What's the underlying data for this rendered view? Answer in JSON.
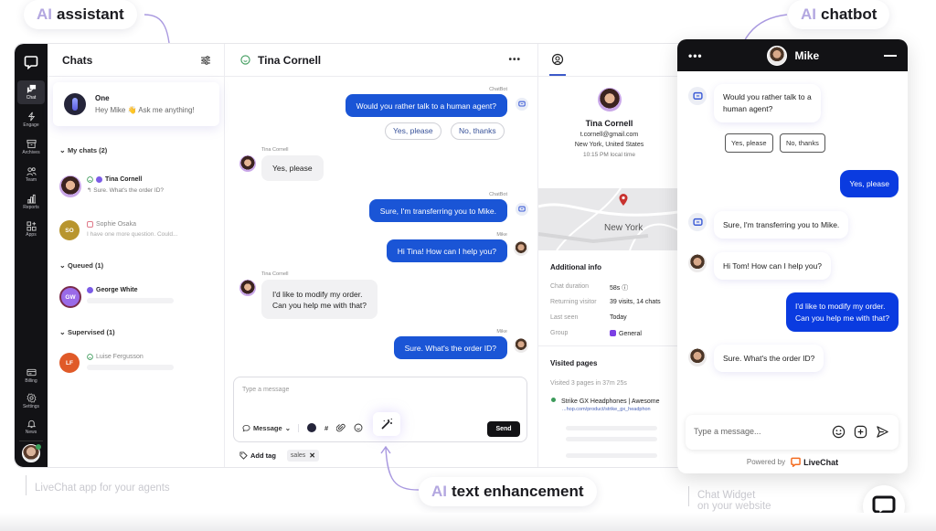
{
  "callouts": {
    "ai_assistant": {
      "prefix": "AI",
      "text": "assistant"
    },
    "ai_chatbot": {
      "prefix": "AI",
      "text": "chatbot"
    },
    "ai_text_enhancement": {
      "prefix": "AI",
      "text": "text enhancement"
    }
  },
  "captions": {
    "agent_app": "LiveChat app for your agents",
    "widget_line1": "Chat Widget",
    "widget_line2": "on your website"
  },
  "nav": {
    "items": [
      {
        "label": "Chat",
        "icon": "chat-icon",
        "active": true
      },
      {
        "label": "Engage",
        "icon": "engage-icon"
      },
      {
        "label": "Archives",
        "icon": "archive-icon"
      },
      {
        "label": "Team",
        "icon": "team-icon"
      },
      {
        "label": "Reports",
        "icon": "reports-icon"
      },
      {
        "label": "Apps",
        "icon": "apps-icon"
      }
    ],
    "bottom_items": [
      {
        "label": "Billing",
        "icon": "billing-icon"
      },
      {
        "label": "Settings",
        "icon": "settings-icon"
      },
      {
        "label": "News",
        "icon": "bell-icon"
      }
    ]
  },
  "chats": {
    "title": "Chats",
    "ai_card": {
      "name": "One",
      "message": "Hey Mike 👋 Ask me anything!"
    },
    "sections": [
      {
        "label": "My chats (2)"
      },
      {
        "label": "Queued (1)"
      },
      {
        "label": "Supervised (1)"
      }
    ],
    "items": [
      {
        "name": "Tina Cornell",
        "preview": "↰ Sure. What's the order ID?"
      },
      {
        "name": "Sophie Osaka",
        "initials": "SO",
        "preview": "I have one more question. Could...",
        "color": "#b8952e"
      },
      {
        "name": "George White",
        "initials": "GW",
        "color": "#9a6ae8"
      },
      {
        "name": "Luise  Fergusson",
        "initials": "LF",
        "color": "#e05a28"
      }
    ]
  },
  "conversation": {
    "title": "Tina Cornell",
    "more": "•••",
    "messages": [
      {
        "sender": "ChatBot",
        "text": "Would you rather talk to a human agent?",
        "dir": "out"
      },
      {
        "sender": "Tina Cornell",
        "text": "Yes, please",
        "dir": "in"
      },
      {
        "sender": "ChatBot",
        "text": "Sure, I'm transferring you to Mike.",
        "dir": "out"
      },
      {
        "sender": "Mike",
        "text": "Hi Tina! How can I help you?",
        "dir": "out"
      },
      {
        "sender": "Tina Cornell",
        "text_line1": "I'd like to modify my order.",
        "text_line2": "Can you help me with that?",
        "dir": "in"
      },
      {
        "sender": "Mike",
        "text": "Sure. What's the order ID?",
        "dir": "out"
      }
    ],
    "quick_replies": [
      "Yes, please",
      "No, thanks"
    ],
    "composer": {
      "placeholder": "Type a message",
      "message_type": "Message",
      "send": "Send"
    },
    "tags": {
      "add_label": "Add tag",
      "items": [
        "sales"
      ]
    }
  },
  "details": {
    "name": "Tina Cornell",
    "email": "t.cornell@gmail.com",
    "location": "New York, United States",
    "local_time": "10:15 PM local time",
    "map_label": "New York",
    "additional_title": "Additional info",
    "info": [
      {
        "label": "Chat duration",
        "value": "58s ⓘ"
      },
      {
        "label": "Returning visitor",
        "value": "39 visits, 14 chats"
      },
      {
        "label": "Last seen",
        "value": "Today"
      },
      {
        "label": "Group",
        "value": "General"
      }
    ],
    "visited_title": "Visited pages",
    "visited_summary": "Visited 3 pages in 37m 25s",
    "pages": [
      {
        "title": "Strike GX Headphones | Awesome",
        "url": "...hop.com/product/strike_gx_headphon"
      }
    ]
  },
  "widget": {
    "agent_name": "Mike",
    "more": "•••",
    "messages": [
      {
        "text_line1": "Would you rather talk to a",
        "text_line2": "human agent?",
        "dir": "in",
        "from": "bot"
      },
      {
        "text": "Yes, please",
        "dir": "out"
      },
      {
        "text": "Sure, I'm transferring you to Mike.",
        "dir": "in",
        "from": "bot"
      },
      {
        "text": "Hi Tom! How can I help you?",
        "dir": "in",
        "from": "agent"
      },
      {
        "text_line1": "I'd like to modify my order.",
        "text_line2": "Can you help me with that?",
        "dir": "out"
      },
      {
        "text": "Sure. What's the order ID?",
        "dir": "in",
        "from": "agent"
      }
    ],
    "quick_replies": [
      "Yes, please",
      "No, thanks"
    ],
    "input_placeholder": "Type a message...",
    "powered_by": "Powered by",
    "brand": "LiveChat"
  },
  "colors": {
    "accent_blue": "#1a55d6",
    "widget_blue": "#0a3be0",
    "dark": "#121215",
    "ai_purple": "#b3a7e0"
  }
}
